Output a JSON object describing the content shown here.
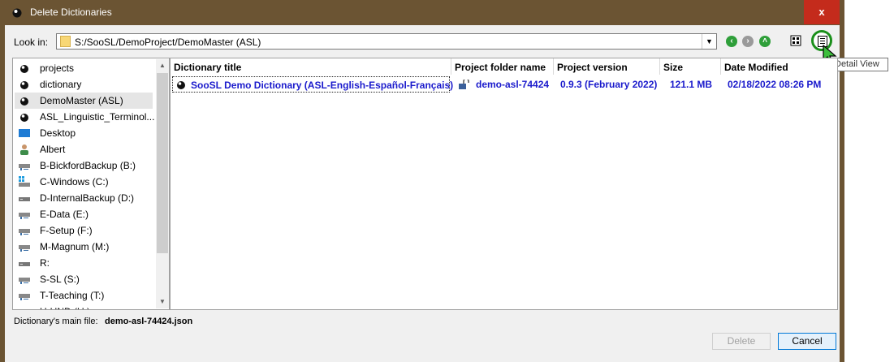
{
  "window": {
    "title": "Delete Dictionaries",
    "close_label": "x"
  },
  "lookin": {
    "label": "Look in:",
    "path": "S:/SooSL/DemoProject/DemoMaster (ASL)"
  },
  "tooltip": {
    "text": "Detail View"
  },
  "sidebar": {
    "items": [
      {
        "label": "projects",
        "icon": "soosl-icon"
      },
      {
        "label": "dictionary",
        "icon": "soosl-icon"
      },
      {
        "label": "DemoMaster (ASL)",
        "icon": "soosl-icon"
      },
      {
        "label": "ASL_Linguistic_Terminol...",
        "icon": "soosl-icon"
      },
      {
        "label": "Desktop",
        "icon": "desktop-icon"
      },
      {
        "label": "Albert",
        "icon": "user-icon"
      },
      {
        "label": "B-BickfordBackup (B:)",
        "icon": "network-drive-icon"
      },
      {
        "label": "C-Windows (C:)",
        "icon": "windows-drive-icon"
      },
      {
        "label": "D-InternalBackup (D:)",
        "icon": "drive-icon"
      },
      {
        "label": "E-Data (E:)",
        "icon": "network-drive-icon"
      },
      {
        "label": "F-Setup (F:)",
        "icon": "network-drive-icon"
      },
      {
        "label": "M-Magnum (M:)",
        "icon": "network-drive-icon"
      },
      {
        "label": "R:",
        "icon": "drive-icon"
      },
      {
        "label": "S-SL (S:)",
        "icon": "network-drive-icon"
      },
      {
        "label": "T-Teaching (T:)",
        "icon": "network-drive-icon"
      },
      {
        "label": "U-UND (U:)",
        "icon": "network-drive-icon"
      }
    ]
  },
  "table": {
    "columns": [
      "Dictionary title",
      "Project folder name",
      "Project version",
      "Size",
      "Date Modified"
    ],
    "rows": [
      {
        "title": "SooSL Demo Dictionary (ASL-English-Español-Français)",
        "folder": "demo-asl-74424",
        "version": "0.9.3 (February 2022)",
        "size": "121.1 MB",
        "date": "02/18/2022 08:26 PM"
      }
    ]
  },
  "footer": {
    "mainfile_label": "Dictionary's main file:",
    "mainfile_value": "demo-asl-74424.json",
    "delete_label": "Delete",
    "cancel_label": "Cancel"
  },
  "colors": {
    "titlebar": "#6b5433",
    "close": "#c42b1c",
    "link_text": "#1a1acc",
    "highlight_ring": "#1a8f1a"
  }
}
